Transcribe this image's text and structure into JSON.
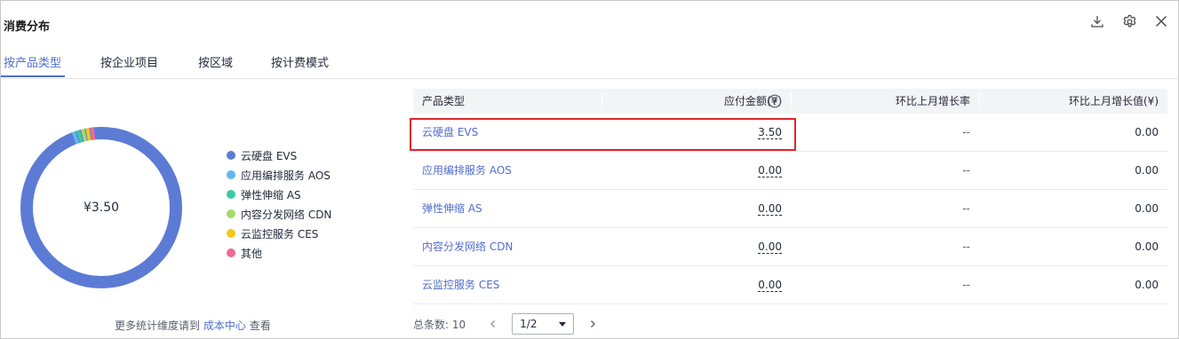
{
  "header": {
    "title": "消费分布",
    "icons": [
      "download-icon",
      "gear-icon",
      "close-icon"
    ]
  },
  "tabs": [
    {
      "label": "按产品类型",
      "active": true
    },
    {
      "label": "按企业项目",
      "active": false
    },
    {
      "label": "按区域",
      "active": false
    },
    {
      "label": "按计费模式",
      "active": false
    }
  ],
  "donut": {
    "center_label": "¥3.50",
    "colors": [
      "#5b7bd5",
      "#62b6ee",
      "#3cc9a0",
      "#a6d96a",
      "#f5c518",
      "#ee6b94"
    ]
  },
  "legend": [
    {
      "label": "云硬盘 EVS",
      "color": "#5b7bd5"
    },
    {
      "label": "应用编排服务 AOS",
      "color": "#62b6ee"
    },
    {
      "label": "弹性伸缩 AS",
      "color": "#3cc9a0"
    },
    {
      "label": "内容分发网络 CDN",
      "color": "#a6d96a"
    },
    {
      "label": "云监控服务 CES",
      "color": "#f5c518"
    },
    {
      "label": "其他",
      "color": "#ee6b94"
    }
  ],
  "footnote": {
    "prefix": "更多统计维度请到",
    "link": "成本中心",
    "suffix": "查看"
  },
  "table": {
    "headers": {
      "name": "产品类型",
      "amount": "应付金额(¥)",
      "rate": "环比上月增长率",
      "delta": "环比上月增长值(¥)"
    },
    "rows": [
      {
        "name": "云硬盘 EVS",
        "amount": "3.50",
        "rate": "--",
        "delta": "0.00"
      },
      {
        "name": "应用编排服务 AOS",
        "amount": "0.00",
        "rate": "--",
        "delta": "0.00"
      },
      {
        "name": "弹性伸缩 AS",
        "amount": "0.00",
        "rate": "--",
        "delta": "0.00"
      },
      {
        "name": "内容分发网络 CDN",
        "amount": "0.00",
        "rate": "--",
        "delta": "0.00"
      },
      {
        "name": "云监控服务 CES",
        "amount": "0.00",
        "rate": "--",
        "delta": "0.00"
      }
    ]
  },
  "pager": {
    "total_label": "总条数: 10",
    "page_value": "1/2"
  }
}
